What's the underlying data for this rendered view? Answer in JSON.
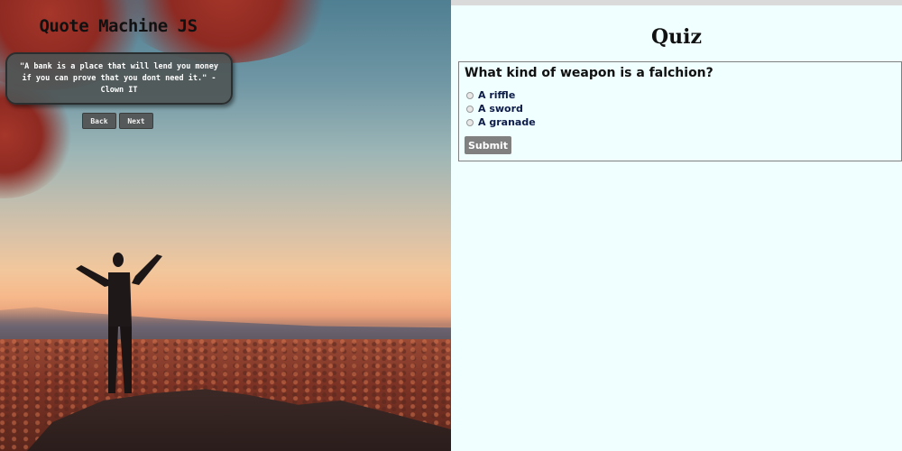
{
  "quote_machine": {
    "title": "Quote Machine JS",
    "quote": "\"A bank is a place that will lend you money if you can prove that you dont need it.\" - Clown IT",
    "back_label": "Back",
    "next_label": "Next"
  },
  "quiz": {
    "title": "Quiz",
    "question": "What kind of weapon is a falchion?",
    "options": [
      {
        "label": "A riffle",
        "selected": false
      },
      {
        "label": "A sword",
        "selected": false
      },
      {
        "label": "A granade",
        "selected": false
      }
    ],
    "submit_label": "Submit"
  },
  "colors": {
    "quiz_background": "#f0ffff",
    "option_text": "#0e1c4a",
    "submit_button": "#808080",
    "quote_box": "#4e5454"
  }
}
